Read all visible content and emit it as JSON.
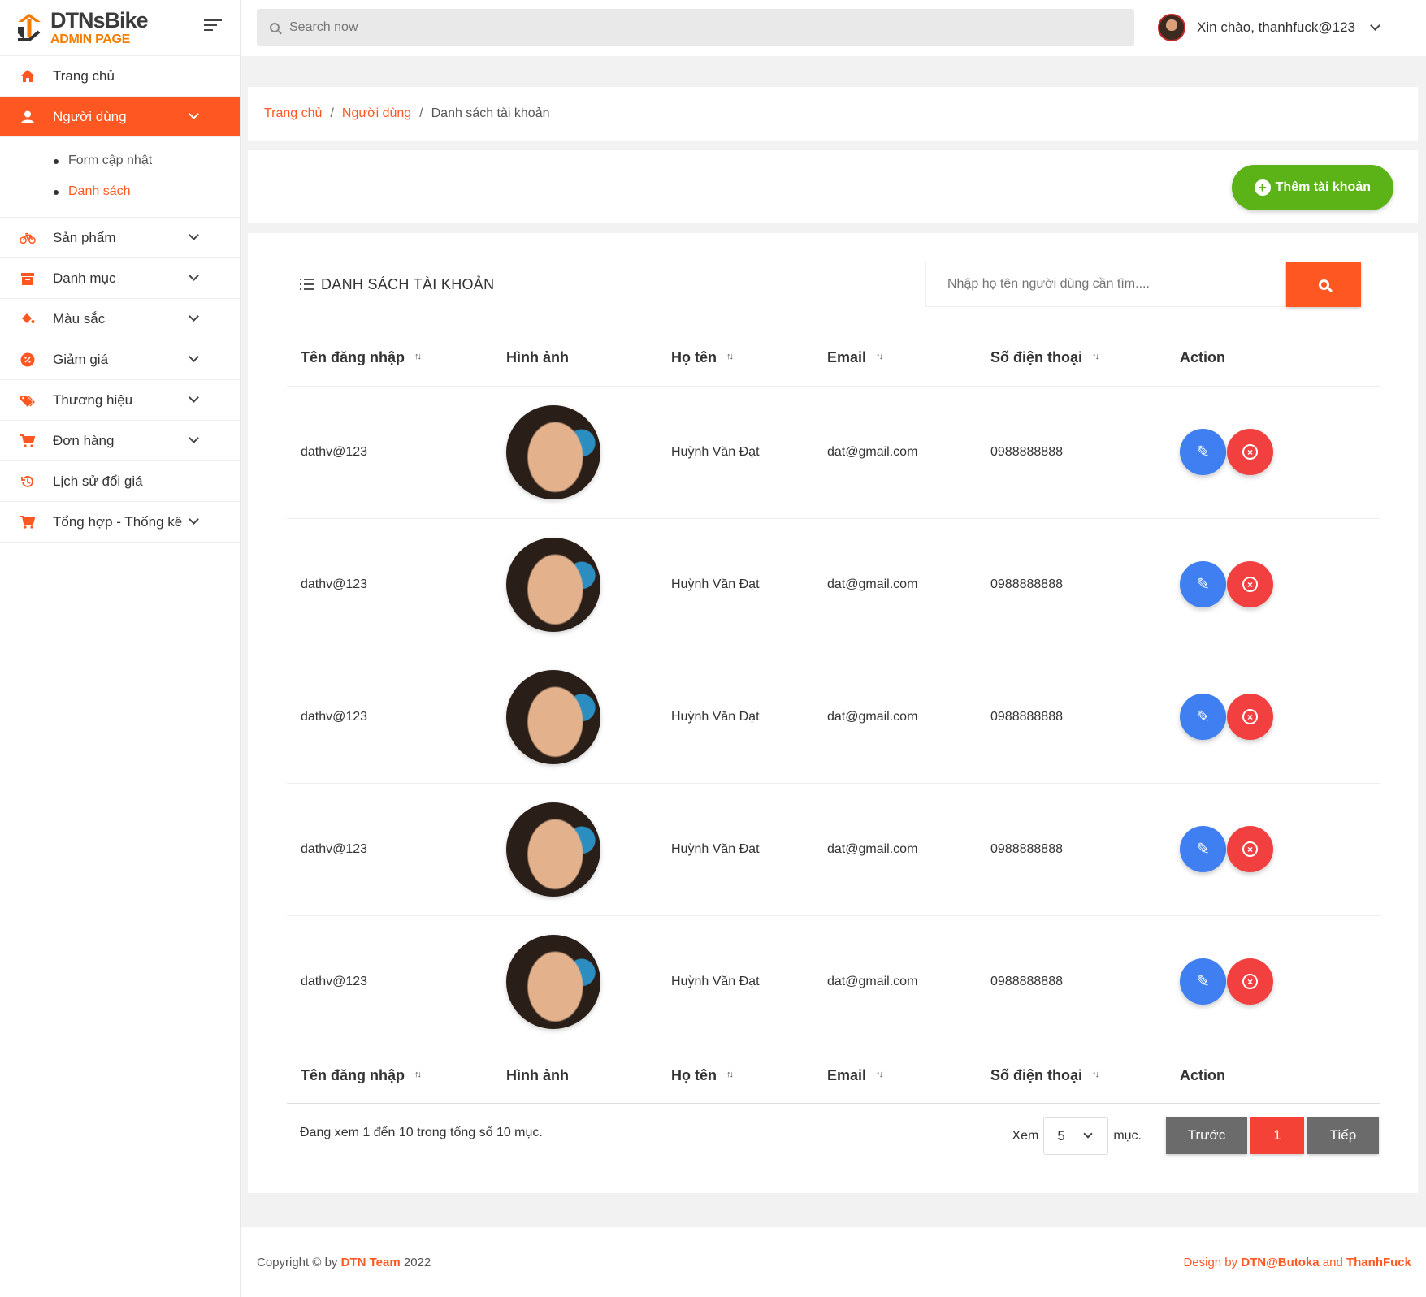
{
  "brand": {
    "name": "DTNsBike",
    "subtitle": "ADMIN PAGE"
  },
  "header": {
    "search_placeholder": "Search now",
    "greeting": "Xin chào, thanhfuck@123"
  },
  "sidebar": {
    "items": [
      {
        "label": "Trang chủ",
        "icon": "home-icon"
      },
      {
        "label": "Người dùng",
        "icon": "user-icon",
        "active": true
      },
      {
        "label": "Sản phẩm",
        "icon": "bicycle-icon"
      },
      {
        "label": "Danh mục",
        "icon": "archive-icon"
      },
      {
        "label": "Màu sắc",
        "icon": "paint-bucket-icon"
      },
      {
        "label": "Giảm giá",
        "icon": "discount-icon"
      },
      {
        "label": "Thương hiệu",
        "icon": "tag-icon"
      },
      {
        "label": "Đơn hàng",
        "icon": "cart-icon"
      },
      {
        "label": "Lịch sử đổi giá",
        "icon": "history-icon"
      },
      {
        "label": "Tổng hợp - Thống kê",
        "icon": "cart-icon"
      }
    ],
    "submenu": [
      {
        "label": "Form cập nhật"
      },
      {
        "label": "Danh sách",
        "active": true
      }
    ]
  },
  "breadcrumb": {
    "home": "Trang chủ",
    "users": "Người dùng",
    "current": "Danh sách tài khoản",
    "separator": "/"
  },
  "actions": {
    "add_account": "Thêm tài khoản"
  },
  "table": {
    "title": "DANH SÁCH TÀI KHOẢN",
    "search_placeholder": "Nhập họ tên người dùng cần tìm....",
    "columns": [
      "Tên đăng nhập",
      "Hình ảnh",
      "Họ tên",
      "Email",
      "Số điện thoại",
      "Action"
    ],
    "rows": [
      {
        "username": "dathv@123",
        "fullname": "Huỳnh Văn Đạt",
        "email": "dat@gmail.com",
        "phone": "0988888888"
      },
      {
        "username": "dathv@123",
        "fullname": "Huỳnh Văn Đạt",
        "email": "dat@gmail.com",
        "phone": "0988888888"
      },
      {
        "username": "dathv@123",
        "fullname": "Huỳnh Văn Đạt",
        "email": "dat@gmail.com",
        "phone": "0988888888"
      },
      {
        "username": "dathv@123",
        "fullname": "Huỳnh Văn Đạt",
        "email": "dat@gmail.com",
        "phone": "0988888888"
      },
      {
        "username": "dathv@123",
        "fullname": "Huỳnh Văn Đạt",
        "email": "dat@gmail.com",
        "phone": "0988888888"
      }
    ],
    "info": "Đang xem 1 đến 10 trong tổng số 10 mục.",
    "page_size_prefix": "Xem",
    "page_size": "5",
    "page_size_suffix": "mục.",
    "prev": "Trước",
    "current_page": "1",
    "next": "Tiếp"
  },
  "footer": {
    "copyright_prefix": "Copyright © by",
    "team": "DTN Team",
    "year": "2022",
    "design_prefix": "Design by",
    "designer1": "DTN@Butoka",
    "and": "and",
    "designer2": "ThanhFuck"
  },
  "colors": {
    "accent": "#ff5722",
    "add_button": "#5bb318",
    "edit": "#3f7ff1",
    "delete": "#f23f3f",
    "pager": "#6b6b6b"
  }
}
